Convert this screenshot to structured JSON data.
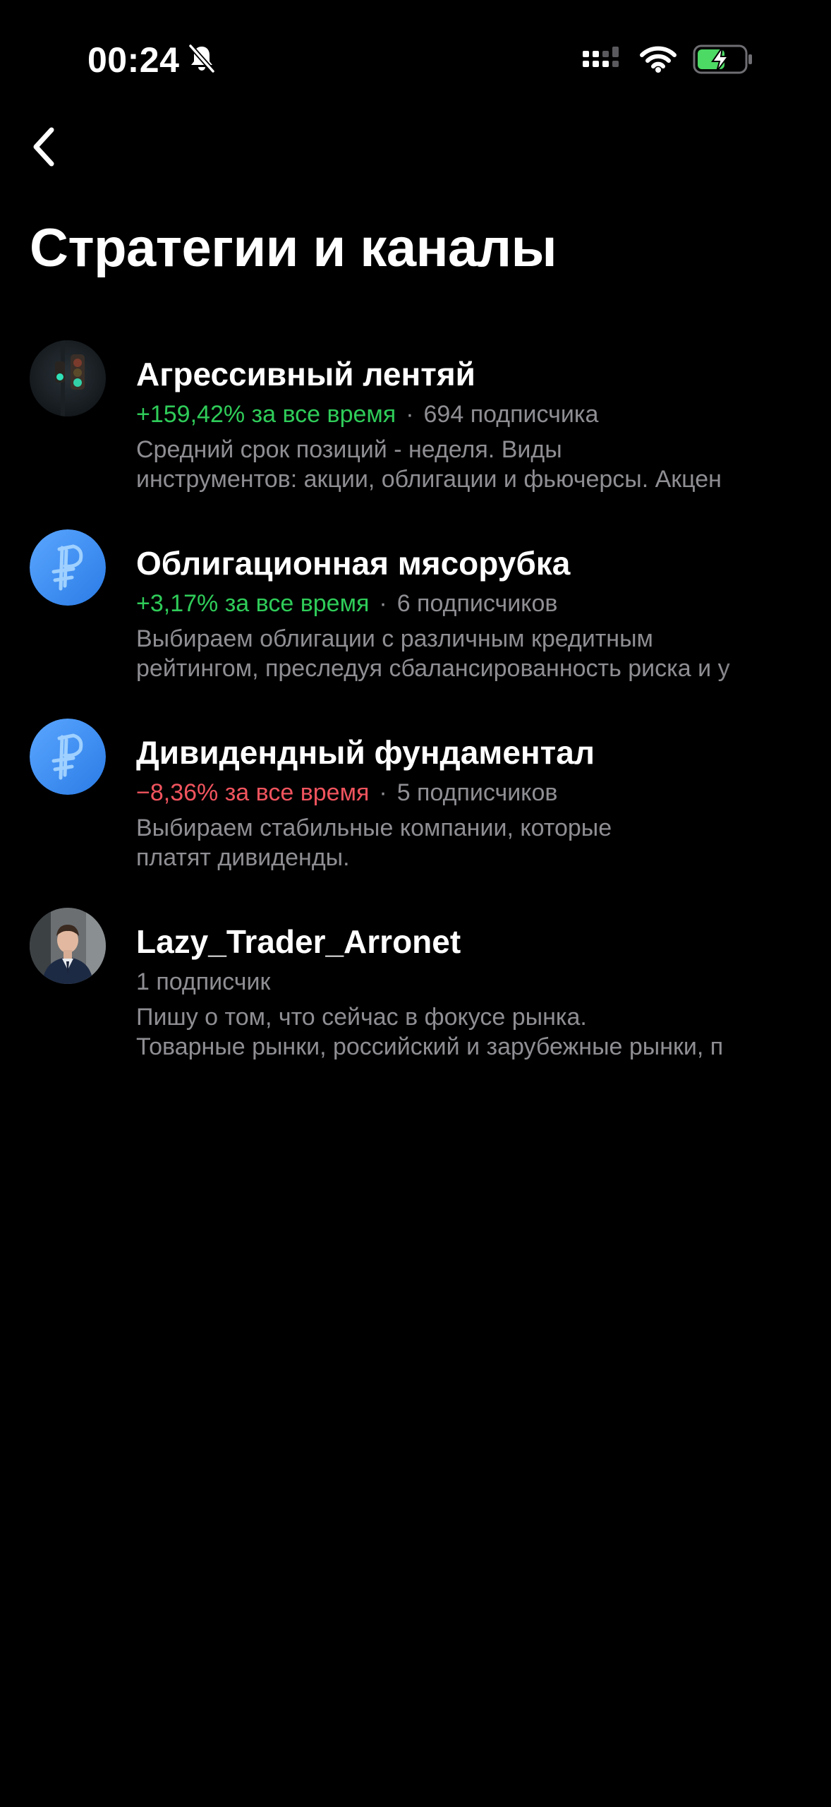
{
  "status_bar": {
    "time": "00:24",
    "icons": [
      "bell-slash-icon",
      "signal-icon",
      "wifi-icon",
      "battery-charging-icon"
    ],
    "battery_color": "#4cd964"
  },
  "nav": {
    "back_icon": "chevron-left-icon"
  },
  "header": {
    "title": "Стратегии и каналы"
  },
  "colors": {
    "positive": "#2fcc59",
    "negative": "#f0545e",
    "secondary_text": "#8e8e93",
    "avatar_blue": "#3b8ef0"
  },
  "items": [
    {
      "title": "Агрессивный лентяй",
      "return": "+159,42% за все время",
      "subscribers": "694 подписчика",
      "desc_line1": "Средний срок позиций - неделя. Виды",
      "desc_line2": "инструментов: акции, облигации и фьючерсы. Акцен",
      "avatar": "traffic-light-photo"
    },
    {
      "title": "Облигационная мясорубка",
      "return": "+3,17% за все время",
      "subscribers": "6 подписчиков",
      "desc_line1": "Выбираем облигации с различным кредитным",
      "desc_line2": "рейтингом, преследуя сбалансированность риска и у",
      "avatar": "ruble-logo"
    },
    {
      "title": "Дивидендный фундаментал",
      "return": "−8,36% за все время",
      "subscribers": "5 подписчиков",
      "desc_line1": "Выбираем стабильные компании, которые",
      "desc_line2": "платят дивиденды.",
      "avatar": "ruble-logo"
    },
    {
      "title": "Lazy_Trader_Arronet",
      "subscribers": "1 подписчик",
      "desc_line1": "Пишу о том, что сейчас в фокусе рынка.",
      "desc_line2": "Товарные рынки, российский и зарубежные рынки, п",
      "avatar": "person-photo"
    }
  ]
}
